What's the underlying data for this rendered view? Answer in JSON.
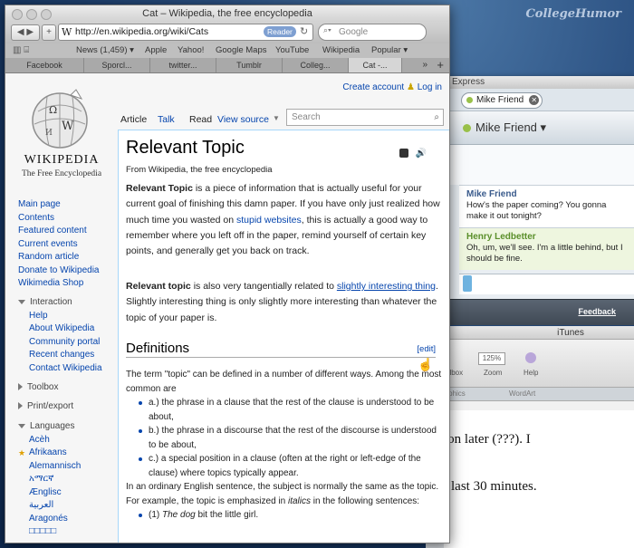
{
  "watermark": "CollegeHumor",
  "safari": {
    "window_title": "Cat – Wikipedia, the free encyclopedia",
    "url": "http://en.wikipedia.org/wiki/Cats",
    "reader_label": "Reader",
    "search_placeholder": "Google",
    "bookmarks": [
      "News (1,459) ▾",
      "Apple",
      "Yahoo!",
      "Google Maps",
      "YouTube",
      "Wikipedia",
      "Popular ▾"
    ],
    "tabs": [
      "Facebook",
      "Sporcl...",
      "twitter...",
      "Tumblr",
      "Colleg...",
      "Cat -..."
    ]
  },
  "wiki": {
    "wordmark": "WIKIPEDIA",
    "tagline": "The Free Encyclopedia",
    "create_account": "Create account",
    "log_in": "Log in",
    "nav_main": [
      "Main page",
      "Contents",
      "Featured content",
      "Current events",
      "Random article",
      "Donate to Wikipedia",
      "Wikimedia Shop"
    ],
    "interaction_head": "Interaction",
    "interaction_items": [
      "Help",
      "About Wikipedia",
      "Community portal",
      "Recent changes",
      "Contact Wikipedia"
    ],
    "toolbox": "Toolbox",
    "print_export": "Print/export",
    "languages_head": "Languages",
    "languages": [
      "Acèh",
      "Afrikaans",
      "Alemannisch",
      "አማርኛ",
      "Ænglisc",
      "العربية",
      "Aragonés",
      "□□□□□"
    ],
    "tab_article": "Article",
    "tab_talk": "Talk",
    "tab_read": "Read",
    "tab_view_source": "View source",
    "search_placeholder": "Search",
    "article_title": "Relevant Topic",
    "from_line": "From Wikipedia, the free encyclopedia",
    "p1": {
      "bold": "Relevant Topic",
      "text1": " is a piece of information that is actually useful for your current goal of finishing this damn paper. If you have only just realized how much time you wasted on ",
      "link": "stupid websites",
      "text2": ", this is actually a good way to remember where you left off in the paper, remind yourself of certain key points, and generally get you back on track."
    },
    "p2": {
      "bold": "Relevant topic",
      "text1": " is also very tangentially related to ",
      "link": "slightly interesting thing",
      "text2": ". Slightly interesting thing is only slightly more interesting than whatever the topic of your paper is."
    },
    "definitions_heading": "Definitions",
    "edit_label": "[edit]",
    "def_intro": "The term \"topic\" can be defined in a number of different ways. Among the most common are",
    "def_items": [
      "a.) the phrase in a clause that the rest of the clause is understood to be about,",
      "b.) the phrase in a discourse that the rest of the discourse is understood to be about,",
      "c.) a special position in a clause (often at the right or left-edge of the clause) where topics typically appear."
    ],
    "def_para": {
      "text1": "In an ordinary English sentence, the subject is normally the same as the topic. For example, the topic is emphasized in ",
      "italic": "italics",
      "text2": " in the following sentences:"
    },
    "example": {
      "prefix": "(1) ",
      "italic": "The dog",
      "rest": " bit the little girl."
    }
  },
  "chat": {
    "window_label": "Express",
    "contact_pill": "Mike Friend",
    "contact_header": "Mike Friend ▾",
    "messages": [
      {
        "from": "Mike Friend",
        "text": "How's the paper coming? You gonna make it out tonight?"
      },
      {
        "from": "Henry Ledbetter",
        "text": "Oh, um, we'll see. I'm a little behind, but I should be fine."
      }
    ]
  },
  "itunes": {
    "feedback": "Feedback",
    "title": "iTunes"
  },
  "word": {
    "zoom": "125%",
    "zoom_label": "Zoom",
    "help_label": "Help",
    "toolbox_label": "olbox",
    "tab_graphics": "raphics",
    "tab_wordart": "WordArt",
    "line1": "ion later (???). I",
    "line2": "last 30 minutes."
  }
}
